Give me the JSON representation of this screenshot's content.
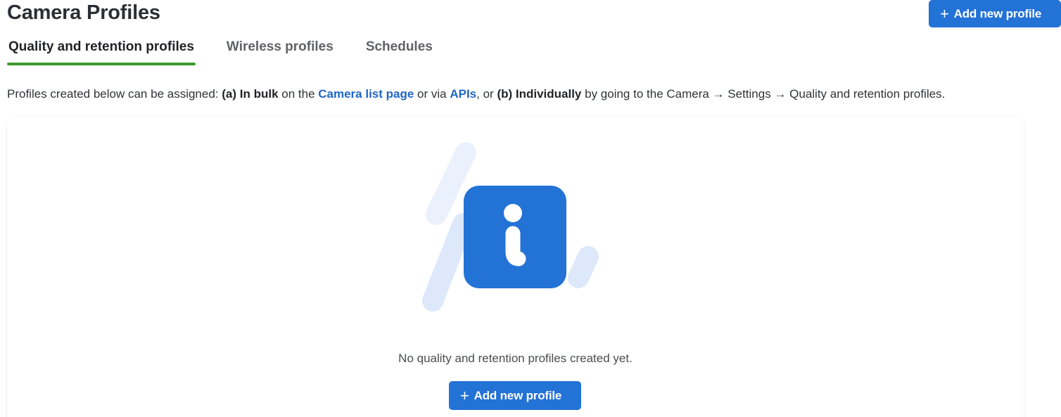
{
  "header": {
    "title": "Camera Profiles",
    "add_button_label": "Add new profile"
  },
  "tabs": [
    {
      "label": "Quality and retention profiles",
      "active": true
    },
    {
      "label": "Wireless profiles",
      "active": false
    },
    {
      "label": "Schedules",
      "active": false
    }
  ],
  "info": {
    "prefix": "Profiles created below can be assigned: ",
    "bulk_bold": "(a) In bulk",
    "on_the": " on the ",
    "camera_list_link": "Camera list page",
    "or_via": " or via ",
    "apis_link": "APIs",
    "comma_or": ", or ",
    "individually_bold": "(b) Individually",
    "suffix": " by going to the Camera → Settings → Quality and retention profiles."
  },
  "empty_state": {
    "icon": "info-icon",
    "message": "No quality and retention profiles created yet.",
    "add_button_label": "Add new profile"
  },
  "colors": {
    "primary": "#2372d6",
    "active_tab_underline": "#3d9a2c",
    "link": "#1f66c5",
    "illustration_light": "#dde8fa"
  }
}
